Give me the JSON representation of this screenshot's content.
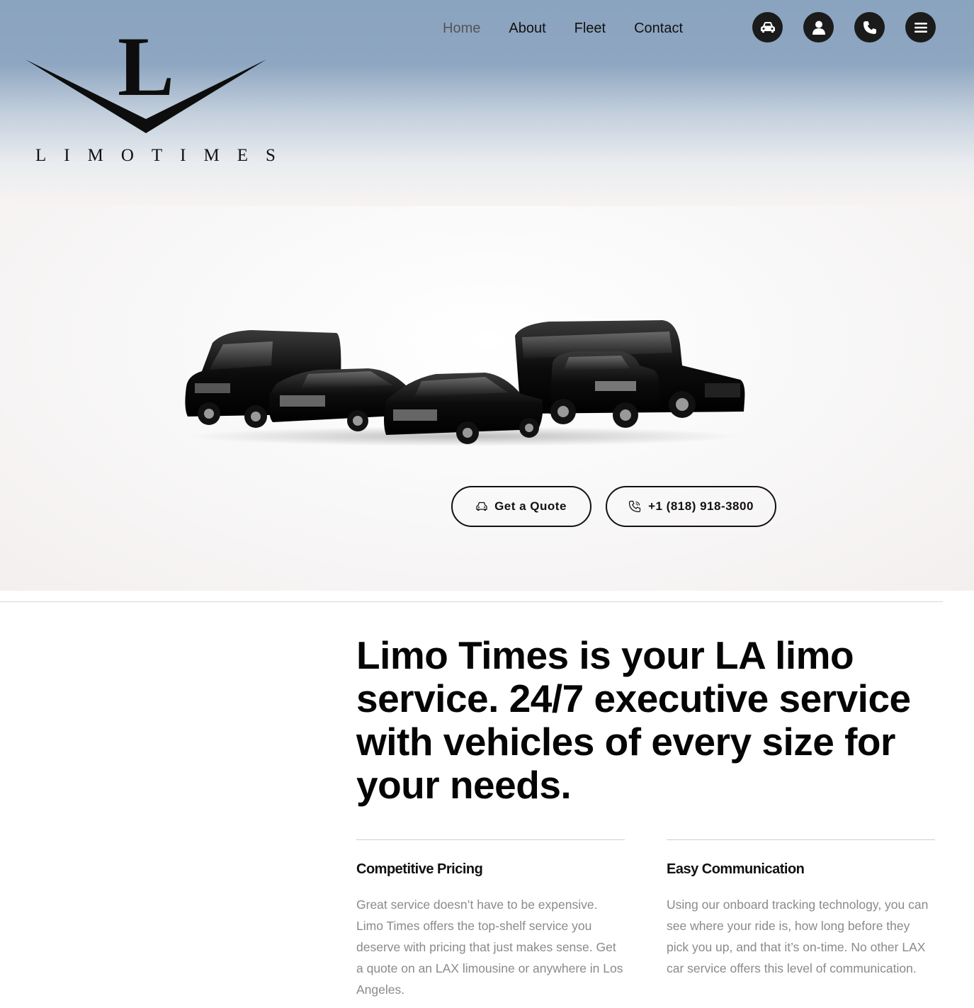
{
  "brand": {
    "wordmark": "LIMOTIMES",
    "letter": "L"
  },
  "nav": {
    "items": [
      {
        "label": "Home",
        "active": true
      },
      {
        "label": "About",
        "active": false
      },
      {
        "label": "Fleet",
        "active": false
      },
      {
        "label": "Contact",
        "active": false
      }
    ]
  },
  "header_icons": [
    "car-icon",
    "user-icon",
    "phone-icon",
    "menu-icon"
  ],
  "hero": {
    "quote_button": "Get a Quote",
    "phone_button": "+1 (818) 918-3800"
  },
  "main": {
    "headline": "Limo Times is your LA limo service. 24/7 executive service with vehicles of every size for your needs.",
    "features": [
      {
        "title": "Competitive Pricing",
        "text": "Great service doesn’t have to be expensive. Limo Times offers the top-shelf service you deserve with pricing that just makes sense. Get a quote on an LAX limousine or anywhere in Los Angeles."
      },
      {
        "title": "Easy Communication",
        "text": "Using our onboard tracking technology, you can see where your ride is, how long before they pick you up, and that it’s on-time. No other LAX car service offers this level of communication."
      }
    ]
  },
  "colors": {
    "header_top": "#8aa3bf",
    "dark": "#1b1b1b",
    "muted_text": "#8a8a8a"
  }
}
